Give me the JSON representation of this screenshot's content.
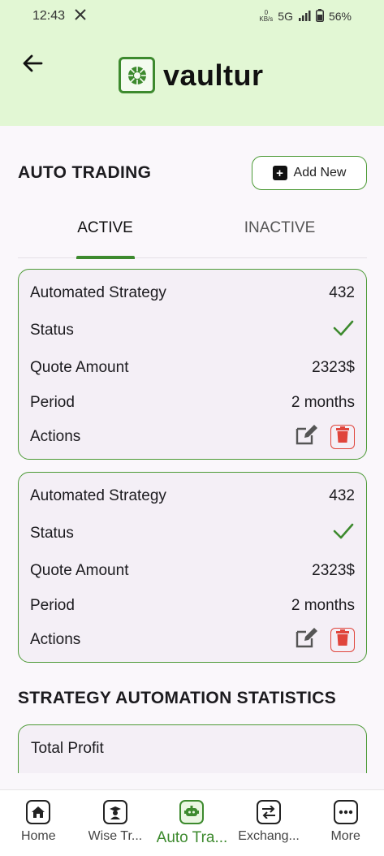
{
  "status_bar": {
    "time": "12:43",
    "x_icon": "x-icon",
    "speed_value": "0",
    "speed_unit": "KB/s",
    "network": "5G",
    "battery": "56%"
  },
  "header": {
    "back_icon": "arrow-left-icon",
    "logo_icon": "vaultur-logo-icon",
    "app_name": "vaultur"
  },
  "page": {
    "title": "AUTO TRADING",
    "add_label": "Add New"
  },
  "tabs": [
    {
      "label": "ACTIVE",
      "active": true
    },
    {
      "label": "INACTIVE",
      "active": false
    }
  ],
  "strategies": [
    {
      "strategy_label": "Automated Strategy",
      "strategy_value": "432",
      "status_label": "Status",
      "quote_label": "Quote Amount",
      "quote_value": "2323$",
      "period_label": "Period",
      "period_value": "2 months",
      "actions_label": "Actions"
    },
    {
      "strategy_label": "Automated Strategy",
      "strategy_value": "432",
      "status_label": "Status",
      "quote_label": "Quote Amount",
      "quote_value": "2323$",
      "period_label": "Period",
      "period_value": "2 months",
      "actions_label": "Actions"
    }
  ],
  "statistics": {
    "title": "STRATEGY AUTOMATION STATISTICS",
    "total_profit_label": "Total Profit"
  },
  "bottom_nav": [
    {
      "label": "Home",
      "icon": "home-icon",
      "active": false
    },
    {
      "label": "Wise Tr...",
      "icon": "teacher-icon",
      "active": false
    },
    {
      "label": "Auto Tra...",
      "icon": "robot-icon",
      "active": true
    },
    {
      "label": "Exchang...",
      "icon": "exchange-icon",
      "active": false
    },
    {
      "label": "More",
      "icon": "more-icon",
      "active": false
    }
  ],
  "colors": {
    "accent": "#3d8a2e",
    "header_bg": "#e2f7d4",
    "danger": "#e0453c"
  }
}
